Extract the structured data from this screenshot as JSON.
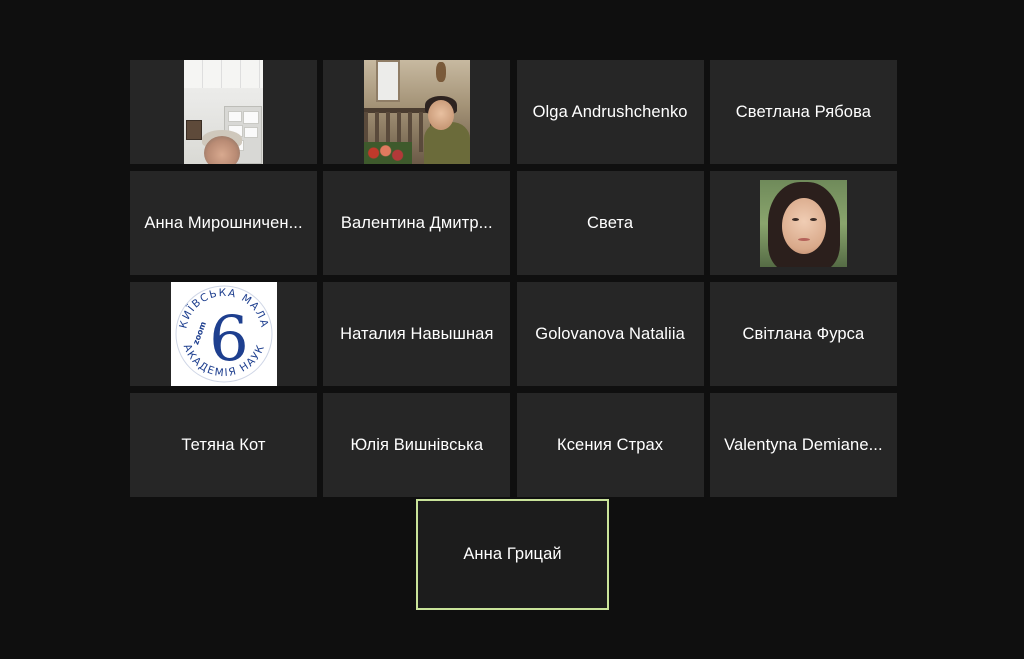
{
  "participants": [
    {
      "name": "",
      "video": "office"
    },
    {
      "name": "",
      "video": "balcony"
    },
    {
      "name": "Olga Andrushchenko"
    },
    {
      "name": "Светлана Рябова"
    },
    {
      "name": "Анна Мирошничен..."
    },
    {
      "name": "Валентина Дмитр..."
    },
    {
      "name": "Света"
    },
    {
      "name": "",
      "video": "portrait"
    },
    {
      "name": "",
      "video": "logo"
    },
    {
      "name": "Наталия Навышная"
    },
    {
      "name": "Golovanova Nataliia"
    },
    {
      "name": "Світлана Фурса"
    },
    {
      "name": "Тетяна Кот"
    },
    {
      "name": "Юлія Вишнівська"
    },
    {
      "name": "Ксения Страх"
    },
    {
      "name": "Valentyna Demiane..."
    }
  ],
  "active_speaker": {
    "name": "Анна Грицай"
  },
  "logo": {
    "arc_top": "КИЇВСЬКА МАЛА",
    "arc_bottom": "АКАДЕМІЯ НАУК",
    "digit": "6",
    "small": "zoom"
  },
  "colors": {
    "background": "#0f0f0f",
    "tile": "#262626",
    "speaker_border": "#c9e39a",
    "logo_blue": "#1e3f8f"
  }
}
